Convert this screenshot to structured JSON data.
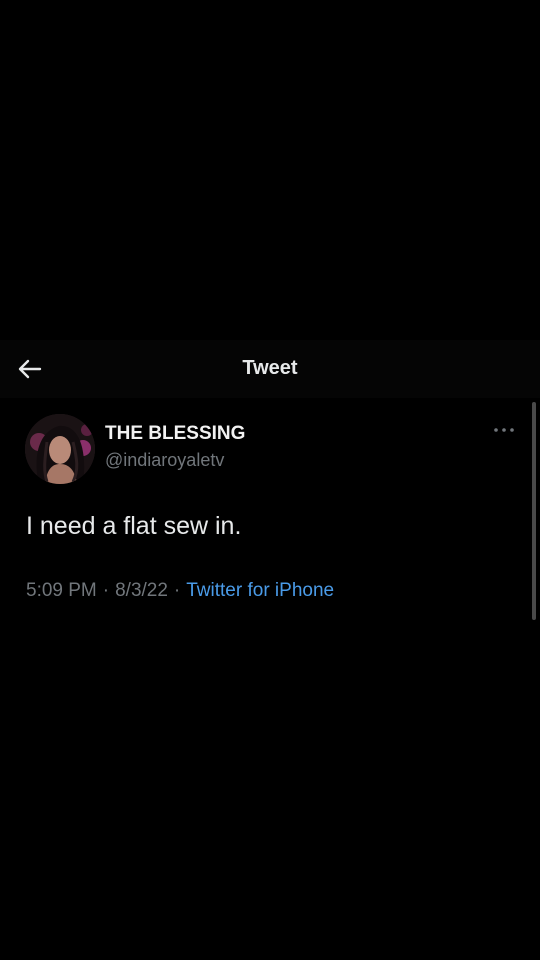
{
  "header": {
    "title": "Tweet",
    "back_icon": "arrow-left-icon"
  },
  "tweet": {
    "author": {
      "display_name": "THE BLESSING",
      "handle": "@indiaroyaletv"
    },
    "text": "I need a flat sew in.",
    "time": "5:09 PM",
    "separator": "·",
    "date": "8/3/22",
    "source": "Twitter for iPhone",
    "more_icon": "more-horizontal-icon"
  },
  "colors": {
    "background": "#000000",
    "text_primary": "#e7e9ea",
    "text_secondary": "#71767b",
    "link": "#4a9be8"
  }
}
